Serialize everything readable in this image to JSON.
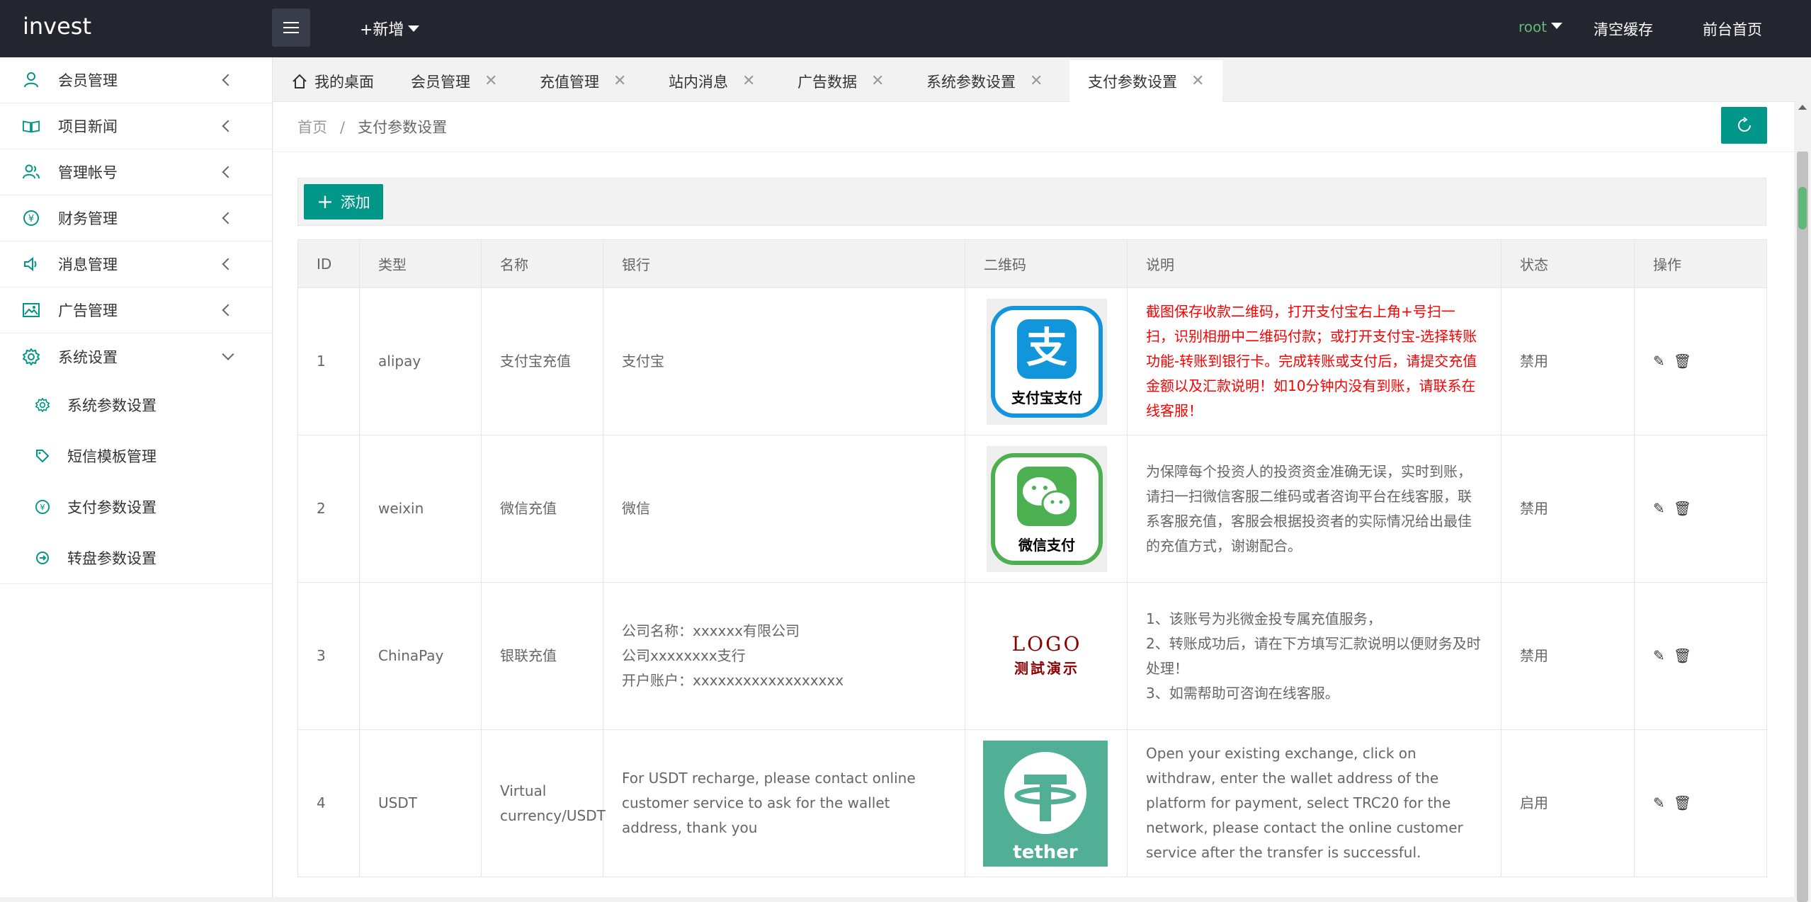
{
  "header": {
    "logo": "invest",
    "new_label": "+新增",
    "user": "root",
    "clear_cache": "清空缓存",
    "front_home": "前台首页"
  },
  "sidebar": {
    "items": [
      {
        "label": "会员管理",
        "icon": "user-icon"
      },
      {
        "label": "项目新闻",
        "icon": "book-icon"
      },
      {
        "label": "管理帐号",
        "icon": "users-icon"
      },
      {
        "label": "财务管理",
        "icon": "yen-icon"
      },
      {
        "label": "消息管理",
        "icon": "speaker-icon"
      },
      {
        "label": "广告管理",
        "icon": "image-icon"
      },
      {
        "label": "系统设置",
        "icon": "gear-icon"
      }
    ],
    "sub_items": [
      {
        "label": "系统参数设置",
        "icon": "gear-icon"
      },
      {
        "label": "短信模板管理",
        "icon": "tag-icon"
      },
      {
        "label": "支付参数设置",
        "icon": "yen-icon"
      },
      {
        "label": "转盘参数设置",
        "icon": "turntable-icon"
      }
    ]
  },
  "tabs": [
    {
      "label": "我的桌面"
    },
    {
      "label": "会员管理"
    },
    {
      "label": "充值管理"
    },
    {
      "label": "站内消息"
    },
    {
      "label": "广告数据"
    },
    {
      "label": "系统参数设置"
    },
    {
      "label": "支付参数设置"
    }
  ],
  "breadcrumb": {
    "home": "首页",
    "sep": "/",
    "current": "支付参数设置"
  },
  "toolbar": {
    "add_label": "添加"
  },
  "table": {
    "headers": [
      "ID",
      "类型",
      "名称",
      "银行",
      "二维码",
      "说明",
      "状态",
      "操作"
    ],
    "rows": [
      {
        "id": "1",
        "type": "alipay",
        "name": "支付宝充值",
        "bank": "支付宝",
        "qr_label": "支付宝支付",
        "desc": "截图保存收款二维码，打开支付宝右上角+号扫一扫，识别相册中二维码付款；或打开支付宝-选择转账功能-转账到银行卡。完成转账或支付后，请提交充值金额以及汇款说明！如10分钟内没有到账，请联系在线客服！",
        "status": "禁用"
      },
      {
        "id": "2",
        "type": "weixin",
        "name": "微信充值",
        "bank": "微信",
        "qr_label": "微信支付",
        "desc": "为保障每个投资人的投资资金准确无误，实时到账，请扫一扫微信客服二维码或者咨询平台在线客服，联系客服充值，客服会根据投资者的实际情况给出最佳的充值方式，谢谢配合。",
        "status": "禁用"
      },
      {
        "id": "3",
        "type": "ChinaPay",
        "name": "银联充值",
        "bank_lines": [
          "公司名称：xxxxxx有限公司",
          "公司xxxxxxxx支行",
          "开户账户：xxxxxxxxxxxxxxxxxx"
        ],
        "qr_logo": "LOGO",
        "qr_demo": "测試演示",
        "desc_lines": [
          "1、该账号为兆微金投专属充值服务，",
          "2、转账成功后，请在下方填写汇款说明以便财务及时处理！",
          "3、如需帮助可咨询在线客服。"
        ],
        "status": "禁用"
      },
      {
        "id": "4",
        "type": "USDT",
        "name": "Virtual currency/USDT",
        "bank": "For USDT recharge, please contact online customer service to ask for the wallet address, thank you",
        "qr_label": "tether",
        "desc": "Open your existing exchange, click on withdraw, enter the wallet address of the platform for payment, select TRC20 for the network, please contact the online customer service after the transfer is successful.",
        "status": "启用"
      }
    ]
  },
  "colors": {
    "accent": "#009688",
    "topbar": "#23262e",
    "alipay": "#1296db",
    "wechat": "#4caf50",
    "tether": "#50af95",
    "warn": "#ff0000"
  }
}
